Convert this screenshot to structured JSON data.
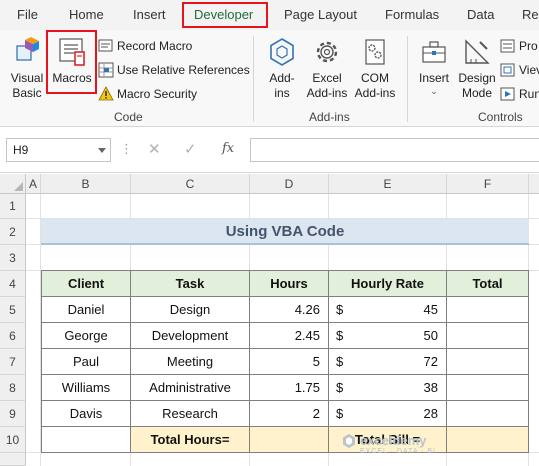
{
  "ribbon_tabs": [
    "File",
    "Home",
    "Insert",
    "Developer",
    "Page Layout",
    "Formulas",
    "Data",
    "Re"
  ],
  "active_tab": "Developer",
  "groups": {
    "code": {
      "label": "Code",
      "visual_basic_1": "Visual",
      "visual_basic_2": "Basic",
      "macros": "Macros",
      "record_macro": "Record Macro",
      "use_relative": "Use Relative References",
      "macro_security": "Macro Security"
    },
    "addins": {
      "label": "Add-ins",
      "addins_1": "Add-",
      "addins_2": "ins",
      "excel_addins_1": "Excel",
      "excel_addins_2": "Add-ins",
      "com_addins_1": "COM",
      "com_addins_2": "Add-ins"
    },
    "controls": {
      "label": "Controls",
      "insert": "Insert",
      "design_mode_1": "Design",
      "design_mode_2": "Mode",
      "properties": "Pro",
      "view_code": "Viev",
      "run_dialog": "Run"
    }
  },
  "formula_bar": {
    "name_box": "H9",
    "fx": "fx",
    "formula": ""
  },
  "columns": [
    "A",
    "B",
    "C",
    "D",
    "E",
    "F"
  ],
  "rows": [
    "1",
    "2",
    "3",
    "4",
    "5",
    "6",
    "7",
    "8",
    "9",
    "10"
  ],
  "sheet": {
    "title": "Using VBA Code",
    "headers": [
      "Client",
      "Task",
      "Hours",
      "Hourly Rate",
      "Total"
    ],
    "data": [
      {
        "client": "Daniel",
        "task": "Design",
        "hours": "4.26",
        "currency": "$",
        "rate": "45"
      },
      {
        "client": "George",
        "task": "Development",
        "hours": "2.45",
        "currency": "$",
        "rate": "50"
      },
      {
        "client": "Paul",
        "task": "Meeting",
        "hours": "5",
        "currency": "$",
        "rate": "72"
      },
      {
        "client": "Williams",
        "task": "Administrative",
        "hours": "1.75",
        "currency": "$",
        "rate": "38"
      },
      {
        "client": "Davis",
        "task": "Research",
        "hours": "2",
        "currency": "$",
        "rate": "28"
      }
    ],
    "total_hours_label": "Total Hours=",
    "total_bill_label": "Total Bill ="
  },
  "watermark": {
    "name": "exceldemy",
    "tagline": "EXCEL · DATA · BI"
  },
  "colors": {
    "highlight_box": "#e8141b",
    "header_fill": "#e2efda",
    "title_fill": "#dce6f1",
    "total_fill": "#fff2cc",
    "accent": "#1f6c3a"
  }
}
